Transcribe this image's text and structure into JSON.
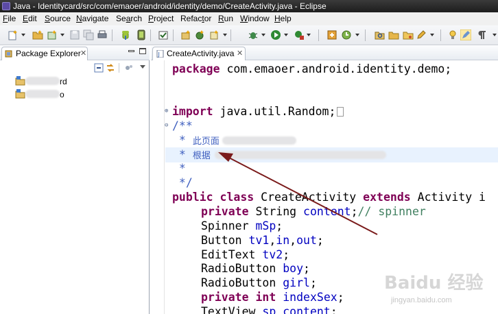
{
  "window": {
    "title": "Java - Identitycard/src/com/emaoer/android/identity/demo/CreateActivity.java - Eclipse"
  },
  "menu": {
    "items": [
      {
        "label": "File",
        "mnemonic": "F",
        "rest": "ile"
      },
      {
        "label": "Edit",
        "mnemonic": "E",
        "rest": "dit"
      },
      {
        "label": "Source",
        "mnemonic": "S",
        "rest": "ource"
      },
      {
        "label": "Navigate",
        "mnemonic": "N",
        "rest": "avigate"
      },
      {
        "label": "Search",
        "mnemonic": "a",
        "pre": "Se",
        "rest": "rch"
      },
      {
        "label": "Project",
        "mnemonic": "P",
        "rest": "roject"
      },
      {
        "label": "Refactor",
        "mnemonic": "t",
        "pre": "Refac",
        "rest": "or"
      },
      {
        "label": "Run",
        "mnemonic": "R",
        "rest": "un"
      },
      {
        "label": "Window",
        "mnemonic": "W",
        "rest": "indow"
      },
      {
        "label": "Help",
        "mnemonic": "H",
        "rest": "elp"
      }
    ]
  },
  "package_explorer": {
    "tab_label": "Package Explorer",
    "close_glyph": "✕",
    "projects": [
      {
        "visible_suffix": "rd"
      },
      {
        "visible_suffix": "o"
      }
    ]
  },
  "editor": {
    "tab_label": "CreateActivity.java",
    "close_glyph": "✕",
    "lines": {
      "package": "package com.emaoer.android.identity.demo;",
      "import_kw": "import",
      "import_rest": " java.util.Random;",
      "javadoc_open": "/**",
      "doc1_prefix": " * ",
      "doc1_visible": "此页面",
      "doc2_prefix": " * ",
      "doc2_visible": "根据",
      "doc3": " *",
      "doc_close": " */",
      "class_kw1": "public",
      "class_kw2": "class",
      "class_name": " CreateActivity ",
      "class_kw3": "extends",
      "class_rest": " Activity i",
      "f1_kw": "private",
      "f1_type": " String ",
      "f1_name": "content",
      "f1_comment": "// spinner",
      "f2_type": "Spinner ",
      "f2_name": "mSp",
      "f3_type": "Button ",
      "f3_names": [
        "tv1",
        "in",
        "out"
      ],
      "f4_type": "EditText ",
      "f4_name": "tv2",
      "f5_type": "RadioButton ",
      "f5_name": "boy",
      "f6_type": "RadioButton ",
      "f6_name": "girl",
      "f7_kw1": "private",
      "f7_kw2": "int",
      "f7_name": "indexSex",
      "f8_type": "TextView ",
      "f8_name": "sp_content"
    }
  },
  "watermark": {
    "main": "Baidu 经验",
    "sub": "jingyan.baidu.com"
  },
  "colors": {
    "keyword": "#7f0055",
    "javadoc": "#3f5fbf",
    "line_comment": "#3f7f5f",
    "field": "#0000c0",
    "annotation_arrow": "#7a1a1a"
  }
}
